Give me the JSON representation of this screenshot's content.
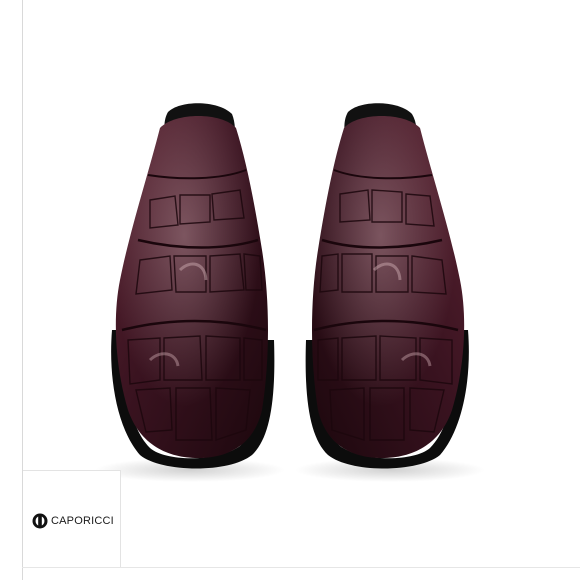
{
  "brand": {
    "name": "CAPORICCI",
    "logo_icon": "caporicci-logo-icon"
  },
  "product": {
    "image_icon": "shoe-pair-icon",
    "colors": {
      "leather_dark": "#2a0f16",
      "leather_mid": "#4a1a26",
      "leather_highlight": "#8a5a66",
      "sole": "#0c0c0c",
      "background": "#ffffff"
    }
  }
}
